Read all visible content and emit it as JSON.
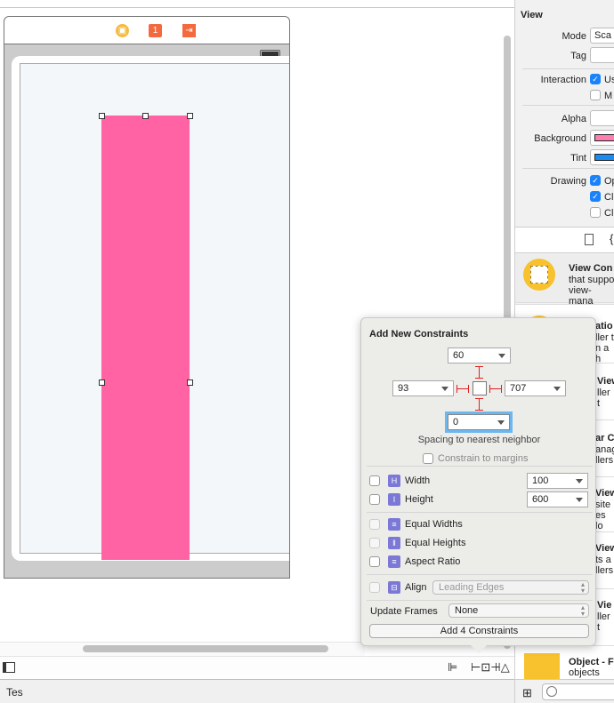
{
  "scene": {
    "dock_icons": [
      "view-controller-icon",
      "first-responder-icon",
      "exit-icon"
    ],
    "view_background": "#ff63a4"
  },
  "inspector": {
    "section_title": "View",
    "mode_label": "Mode",
    "mode_value": "Sca",
    "tag_label": "Tag",
    "interaction_label": "Interaction",
    "interaction_opts": [
      {
        "label": "Us",
        "checked": true
      },
      {
        "label": "M",
        "checked": false
      }
    ],
    "alpha_label": "Alpha",
    "background_label": "Background",
    "background_color": "#ff7eb0",
    "tint_label": "Tint",
    "tint_color": "#1a8cf0",
    "drawing_label": "Drawing",
    "drawing_opts": [
      {
        "label": "Op",
        "checked": true
      },
      {
        "label": "Cl",
        "checked": true
      },
      {
        "label": "Cl",
        "checked": false
      }
    ]
  },
  "library": {
    "items": [
      {
        "title": "View Con",
        "lines": [
          "that suppo",
          "view-mana"
        ]
      },
      {
        "title": "atio",
        "lines": [
          "ller t",
          "n a h"
        ]
      },
      {
        "title": "View",
        "lines": [
          "ller t"
        ]
      },
      {
        "title": "ar C",
        "lines": [
          "anag",
          "llers"
        ]
      },
      {
        "title": "View",
        "lines": [
          "site",
          "es lo"
        ]
      },
      {
        "title": "View",
        "lines": [
          "ts a",
          "llers"
        ]
      },
      {
        "title": "Vie",
        "lines": [
          "ller t"
        ]
      },
      {
        "title": "Object - F",
        "lines": [
          "objects and"
        ]
      }
    ]
  },
  "popover": {
    "title": "Add New Constraints",
    "top": "60",
    "left": "93",
    "right": "707",
    "bottom": "0",
    "spacing_label": "Spacing to nearest neighbor",
    "constrain_margins": "Constrain to margins",
    "width_label": "Width",
    "width_value": "100",
    "height_label": "Height",
    "height_value": "600",
    "equal_widths": "Equal Widths",
    "equal_heights": "Equal Heights",
    "aspect_ratio": "Aspect Ratio",
    "align_label": "Align",
    "align_value": "Leading Edges",
    "update_frames_label": "Update Frames",
    "update_frames_value": "None",
    "add_button": "Add 4 Constraints"
  },
  "status": {
    "text": "Tes"
  }
}
